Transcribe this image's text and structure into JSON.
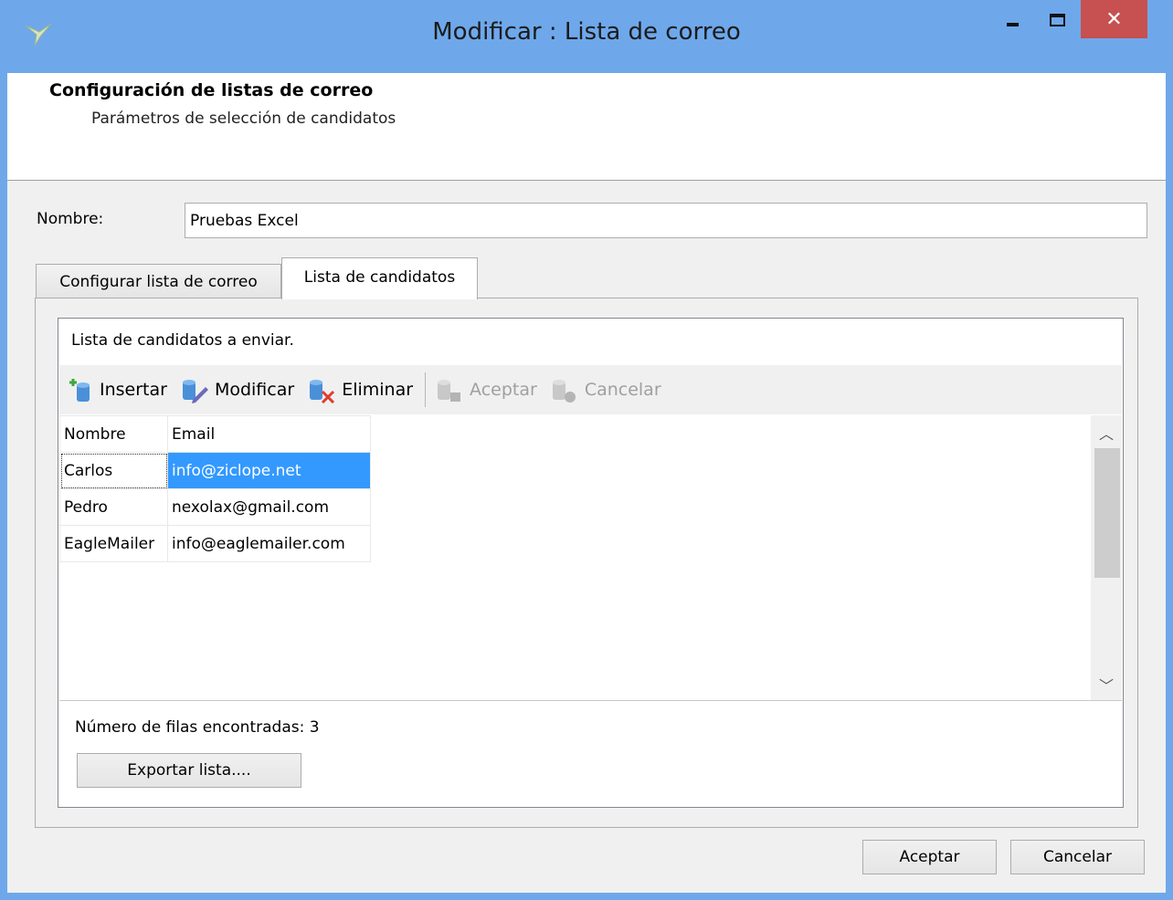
{
  "window": {
    "title": "Modificar : Lista de correo",
    "close_glyph": "✕"
  },
  "header": {
    "title": "Configuración de listas de correo",
    "subtitle": "Parámetros de selección de candidatos"
  },
  "form": {
    "name_label": "Nombre:",
    "name_value": "Pruebas Excel"
  },
  "tabs": [
    {
      "label": "Configurar lista de correo",
      "active": false
    },
    {
      "label": "Lista de candidatos",
      "active": true
    }
  ],
  "panel": {
    "label": "Lista de candidatos a enviar."
  },
  "toolbar": {
    "insert": {
      "label": "Insertar",
      "icon": "insert-icon"
    },
    "modify": {
      "label": "Modificar",
      "icon": "edit-icon"
    },
    "delete": {
      "label": "Eliminar",
      "icon": "delete-icon"
    },
    "accept": {
      "label": "Aceptar",
      "icon": "accept-icon",
      "disabled": true
    },
    "cancel": {
      "label": "Cancelar",
      "icon": "cancel-icon",
      "disabled": true
    }
  },
  "grid": {
    "columns": [
      "Nombre",
      "Email"
    ],
    "rows": [
      {
        "name": "Carlos",
        "email": "info@ziclope.net"
      },
      {
        "name": "Pedro",
        "email": "nexolax@gmail.com"
      },
      {
        "name": "EagleMailer",
        "email": "info@eaglemailer.com"
      }
    ]
  },
  "footer": {
    "rows_label": "Número de filas encontradas:",
    "rows_count": "3",
    "export_label": "Exportar lista...."
  },
  "buttons": {
    "ok": "Aceptar",
    "cancel": "Cancelar"
  },
  "colors": {
    "titlebar": "#6ea8ea",
    "close_button": "#c75050",
    "selection": "#3399ff"
  }
}
